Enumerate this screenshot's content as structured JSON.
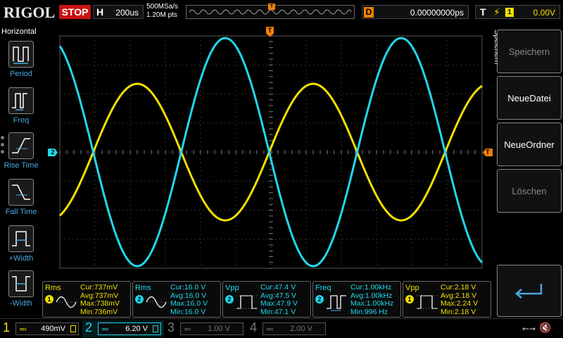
{
  "topbar": {
    "brand": "RIGOL",
    "run_state": "STOP",
    "horizontal_label": "H",
    "timebase": "200us",
    "sample_rate": "500MSa/s",
    "memory_depth": "1.20M pts",
    "trigger_pos_marker": "T",
    "delay_label": "D",
    "delay_value": "0.00000000ps",
    "trigger_label": "T",
    "trigger_edge": "ʃ",
    "trigger_source": "1",
    "trigger_level": "0.00V"
  },
  "left_menu": {
    "title": "Horizontal",
    "items": [
      {
        "label": "Period",
        "icon": "period-icon"
      },
      {
        "label": "Freq",
        "icon": "freq-icon"
      },
      {
        "label": "Rise Time",
        "icon": "rise-time-icon"
      },
      {
        "label": "Fall Time",
        "icon": "fall-time-icon"
      },
      {
        "label": "+Width",
        "icon": "pos-width-icon"
      },
      {
        "label": "-Width",
        "icon": "neg-width-icon"
      }
    ]
  },
  "right_menu": {
    "title": "Speichern",
    "buttons": [
      {
        "label": "Speichern",
        "enabled": false
      },
      {
        "label": "NeueDatei",
        "enabled": true
      },
      {
        "label": "NeueOrdner",
        "enabled": true
      },
      {
        "label": "Löschen",
        "enabled": false
      }
    ],
    "enter_icon": "enter-icon"
  },
  "scope": {
    "ch2_marker": "2",
    "ch1_trigger_marker": "T",
    "top_trigger_marker": "T",
    "trace_colors": {
      "ch1": "#f0e000",
      "ch2": "#1fd8ec"
    }
  },
  "measurements": [
    {
      "name": "Rms",
      "channel": "1",
      "color": "yellow",
      "icon": "sine-wave-icon",
      "cur": "Cur:737mV",
      "avg": "Avg:737mV",
      "max": "Max:738mV",
      "min": "Min:736mV"
    },
    {
      "name": "Rms",
      "channel": "2",
      "color": "cyan",
      "icon": "sine-wave-icon",
      "cur": "Cur:16.0 V",
      "avg": "Avg:16.0 V",
      "max": "Max:16.0 V",
      "min": "Min:16.0 V"
    },
    {
      "name": "Vpp",
      "channel": "2",
      "color": "cyan",
      "icon": "pulse-icon",
      "cur": "Cur:47.4 V",
      "avg": "Avg:47.5 V",
      "max": "Max:47.9 V",
      "min": "Min:47.1 V"
    },
    {
      "name": "Freq",
      "channel": "2",
      "color": "cyan",
      "icon": "freq-pulse-icon",
      "cur": "Cur:1.00kHz",
      "avg": "Avg:1.00kHz",
      "max": "Max:1.00kHz",
      "min": "Min:996 Hz"
    },
    {
      "name": "Vpp",
      "channel": "1",
      "color": "yellow",
      "icon": "pulse-icon",
      "cur": "Cur:2.18 V",
      "avg": "Avg:2.18 V",
      "max": "Max:2.24 V",
      "min": "Min:2.18 V"
    }
  ],
  "channels": [
    {
      "num": "1",
      "scale": "490mV",
      "color": "#f0e000",
      "active": false
    },
    {
      "num": "2",
      "scale": "6.20 V",
      "color": "#1fd8ec",
      "active": true
    },
    {
      "num": "3",
      "scale": "1.00 V",
      "color": "#777777",
      "active": false
    },
    {
      "num": "4",
      "scale": "2.00 V",
      "color": "#777777",
      "active": false
    }
  ],
  "status": {
    "usb_icon": "usb-icon",
    "mute_icon": "speaker-mute-icon"
  }
}
